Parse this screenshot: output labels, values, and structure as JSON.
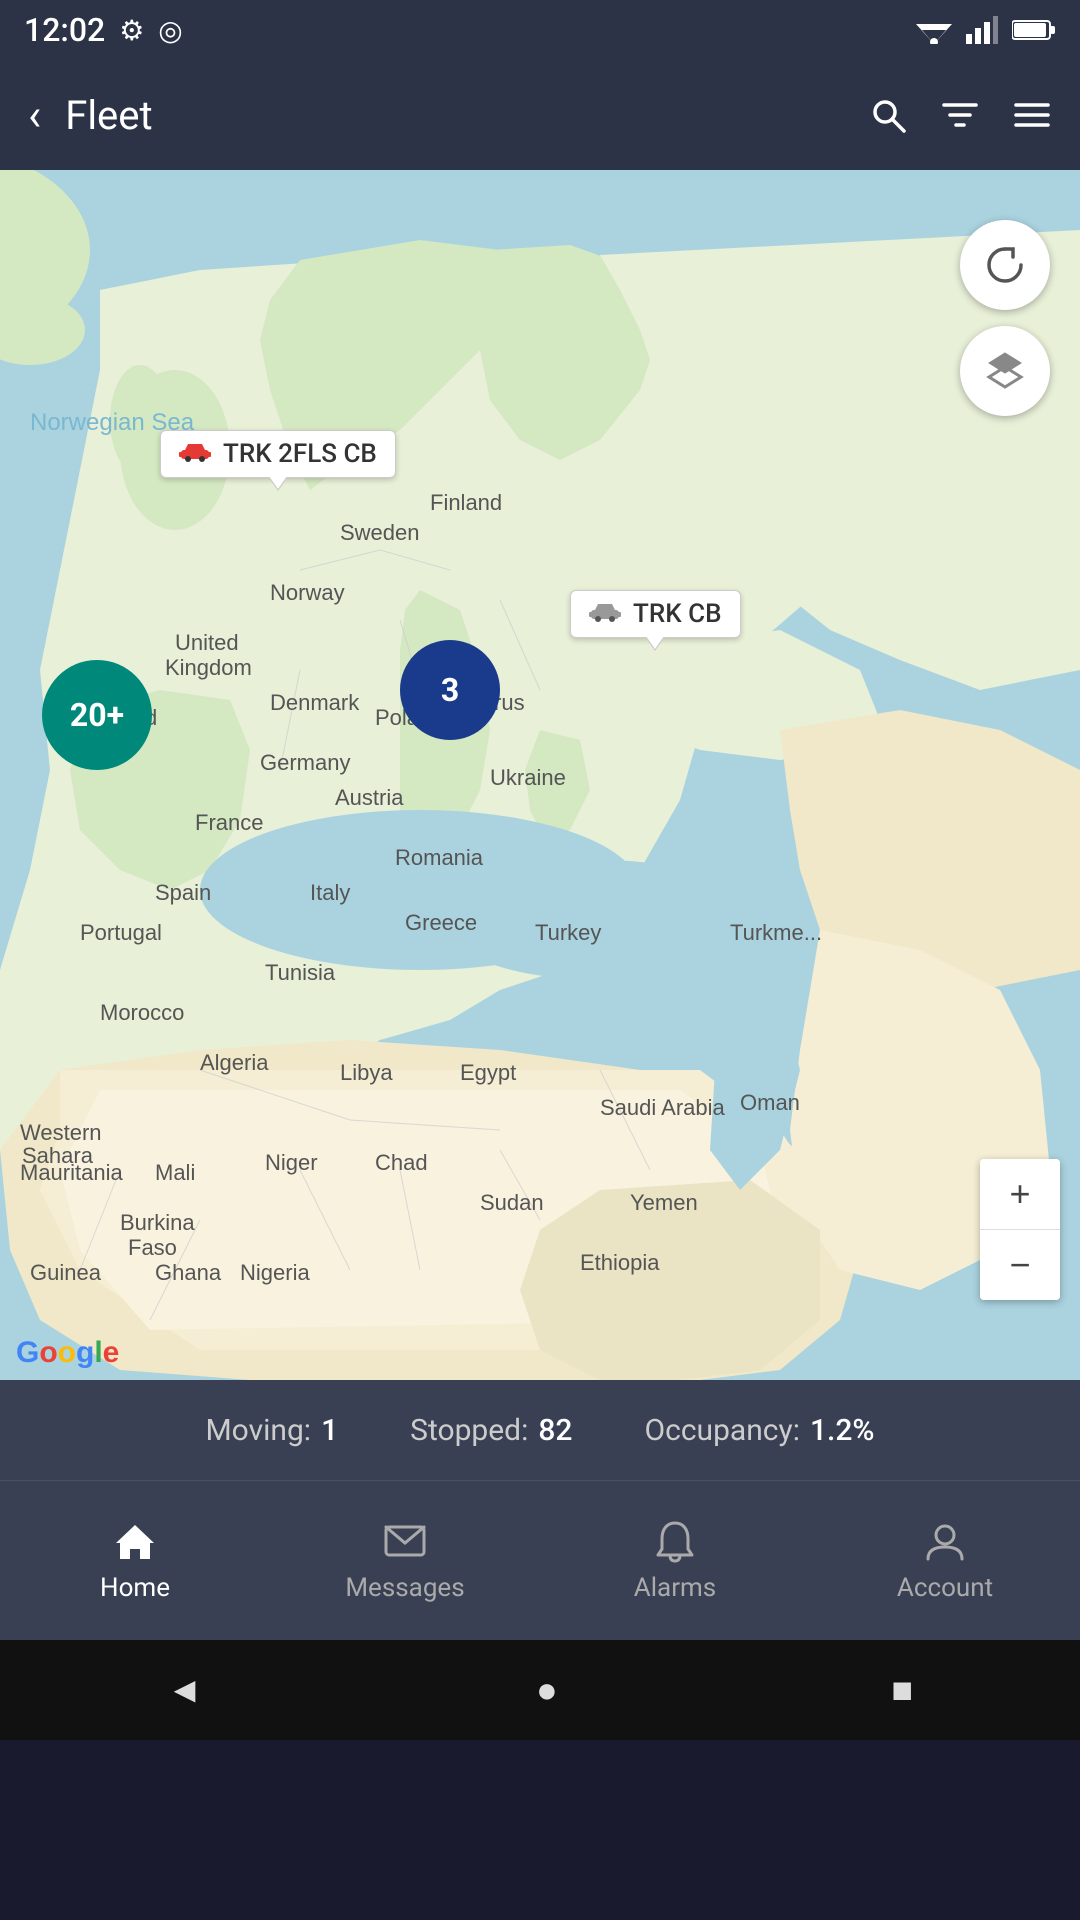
{
  "statusBar": {
    "time": "12:02",
    "settingsIcon": "⚙",
    "atIcon": "◎",
    "wifiIcon": "▲",
    "signalIcon": "▲",
    "batteryIcon": "▐"
  },
  "appBar": {
    "backLabel": "‹",
    "title": "Fleet",
    "searchIcon": "search",
    "filterIcon": "filter",
    "menuIcon": "menu"
  },
  "map": {
    "markers": [
      {
        "id": "cluster-20",
        "label": "20+"
      },
      {
        "id": "cluster-3",
        "label": "3"
      }
    ],
    "callouts": [
      {
        "id": "callout-trk2fls",
        "label": "TRK 2FLS CB",
        "iconColor": "red"
      },
      {
        "id": "callout-trkcb",
        "label": "TRK CB",
        "iconColor": "gray"
      }
    ],
    "refreshIcon": "↻",
    "layersIcon": "◈",
    "zoomIn": "+",
    "zoomOut": "−",
    "googleLogoLetters": [
      "G",
      "o",
      "o",
      "g",
      "l",
      "e"
    ]
  },
  "stats": {
    "movingLabel": "Moving:",
    "movingValue": "1",
    "stoppedLabel": "Stopped:",
    "stoppedValue": "82",
    "occupancyLabel": "Occupancy:",
    "occupancyValue": "1.2%"
  },
  "bottomNav": {
    "items": [
      {
        "id": "home",
        "label": "Home",
        "active": true
      },
      {
        "id": "messages",
        "label": "Messages",
        "active": false
      },
      {
        "id": "alarms",
        "label": "Alarms",
        "active": false
      },
      {
        "id": "account",
        "label": "Account",
        "active": false
      }
    ]
  },
  "systemNav": {
    "backLabel": "◄",
    "homeLabel": "●",
    "recentLabel": "■"
  }
}
